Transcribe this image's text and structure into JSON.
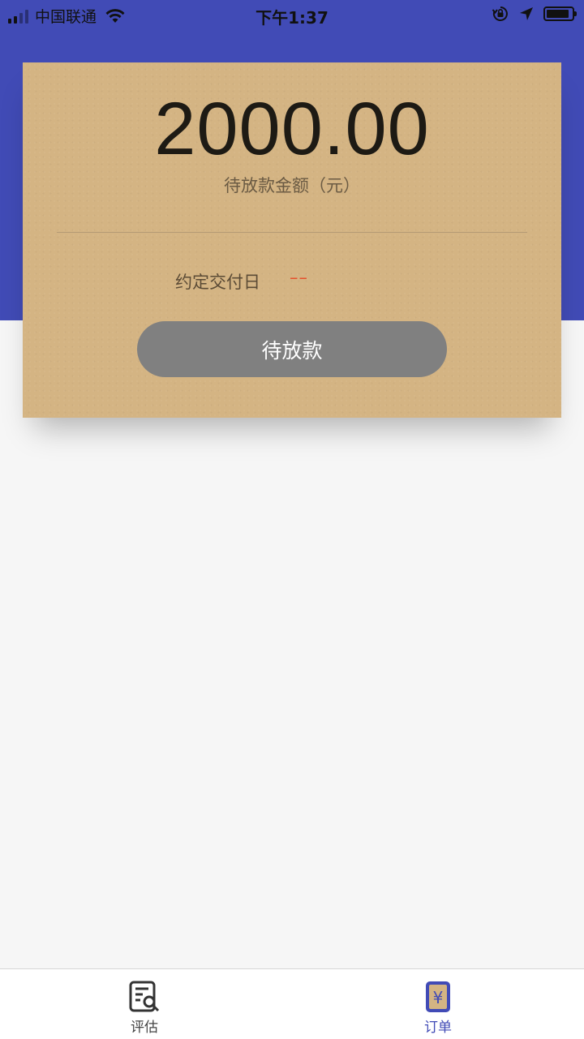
{
  "status_bar": {
    "carrier": "中国联通",
    "time": "下午1:37",
    "icons": [
      "signal-icon",
      "wifi-icon",
      "orientation-lock-icon",
      "location-icon",
      "battery-icon"
    ]
  },
  "colors": {
    "header": "#414bb6",
    "card": "#d4b483",
    "button": "#808080",
    "accent_value": "#e5512c",
    "tab_active": "#414bb6"
  },
  "card": {
    "amount": "2000.00",
    "amount_label": "待放款金额（元）",
    "delivery_label": "约定交付日",
    "delivery_value": "––",
    "button_label": "待放款"
  },
  "tab_bar": {
    "tabs": [
      {
        "label": "评估",
        "icon": "document-search-icon",
        "active": false
      },
      {
        "label": "订单",
        "icon": "yen-order-icon",
        "active": true
      }
    ]
  }
}
